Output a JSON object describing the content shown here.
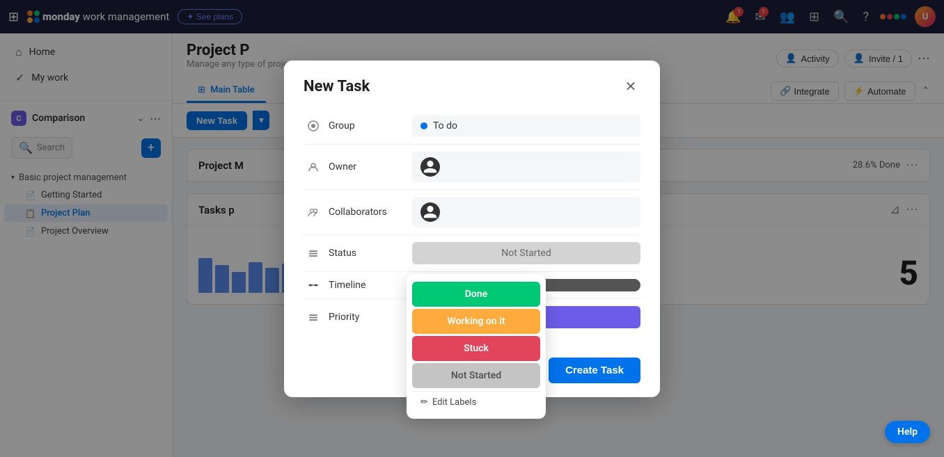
{
  "app": {
    "title": "monday work management",
    "logo_text": "monday",
    "logo_suffix": " work management",
    "see_plans": "✦ See plans"
  },
  "navbar": {
    "notifications_badge": "1",
    "inbox_badge": "1",
    "avatar_initials": "U"
  },
  "sidebar": {
    "collapse_icon": "◀",
    "nav_items": [
      {
        "label": "Home",
        "icon": "⌂"
      },
      {
        "label": "My work",
        "icon": "✓"
      }
    ],
    "workspace": {
      "badge": "C",
      "name": "Comparison"
    },
    "search_placeholder": "Search",
    "add_btn": "+",
    "section": {
      "title": "Basic project management",
      "caret": "▼"
    },
    "items": [
      {
        "label": "Getting Started",
        "icon": "📄",
        "active": false
      },
      {
        "label": "Project Plan",
        "icon": "📋",
        "active": true
      },
      {
        "label": "Project Overview",
        "icon": "📄",
        "active": false
      }
    ]
  },
  "project": {
    "title": "Project P",
    "subtitle": "Manage any type of project...",
    "activity_label": "Activity",
    "invite_label": "Invite / 1",
    "tabs": [
      {
        "label": "Main Table",
        "icon": "⊞",
        "active": true
      }
    ],
    "integrate_label": "Integrate",
    "automate_label": "Automate"
  },
  "toolbar": {
    "new_task_label": "New Task",
    "collapse_icon": "⌃"
  },
  "boards": {
    "section1": {
      "title": "Project M",
      "progress": "28.6% Done",
      "more": "⋯"
    },
    "section2": {
      "title": "Tasks p",
      "tasks_label": "Tasks",
      "more": "⋯",
      "chart_values": [
        1.25,
        1,
        0.75,
        1.1,
        0.9,
        1.05
      ],
      "big_number": "5"
    }
  },
  "modal": {
    "title": "New Task",
    "close": "✕",
    "fields": {
      "group": {
        "label": "Group",
        "value": "To do",
        "dot_color": "#0073ea"
      },
      "owner": {
        "label": "Owner"
      },
      "collaborators": {
        "label": "Collaborators"
      },
      "status": {
        "label": "Status",
        "value": "Not Started"
      },
      "timeline": {
        "label": "Timeline"
      },
      "priority": {
        "label": "Priority"
      }
    },
    "status_dropdown": {
      "options": [
        {
          "label": "Done",
          "class": "done"
        },
        {
          "label": "Working on it",
          "class": "working"
        },
        {
          "label": "Stuck",
          "class": "stuck"
        },
        {
          "label": "Not Started",
          "class": "not-started"
        }
      ],
      "edit_labels": "Edit Labels"
    },
    "create_task_label": "Create Task"
  },
  "help": {
    "label": "Help"
  },
  "icons": {
    "hamburger": "☰",
    "search": "🔍",
    "bell": "🔔",
    "mail": "✉",
    "people": "👥",
    "apps": "⊞",
    "question": "?",
    "pencil": "✏",
    "group_icon": "⬤",
    "owner_icon": "👤",
    "collab_icon": "👥",
    "status_icon": "≡",
    "timeline_icon": "⇶",
    "priority_icon": "≡"
  }
}
